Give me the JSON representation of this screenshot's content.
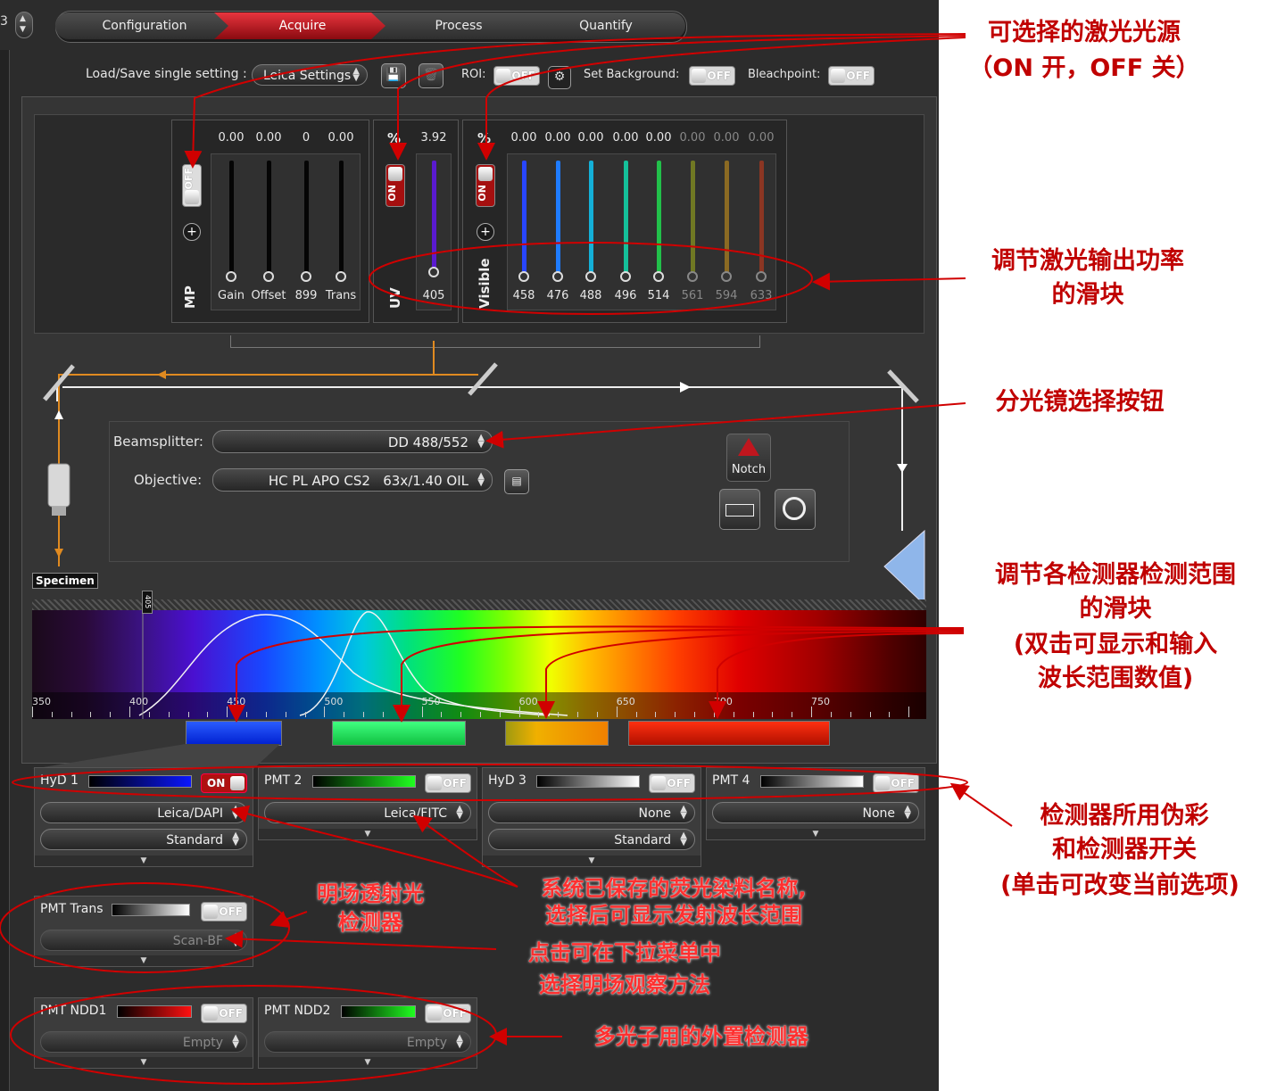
{
  "workflow": {
    "left_spinner_digit": "3",
    "tabs": [
      "Configuration",
      "Acquire",
      "Process",
      "Quantify"
    ]
  },
  "settings_row": {
    "load_save_label": "Load/Save single setting :",
    "setting_value": "Leica Settings",
    "roi_label": "ROI:",
    "roi_state": "OFF",
    "set_background_label": "Set Background:",
    "set_background_state": "OFF",
    "bleachpoint_label": "Bleachpoint:",
    "bleachpoint_state": "OFF"
  },
  "laser_panels": {
    "mp": {
      "title": "MP",
      "state": "OFF",
      "values": [
        "0.00",
        "0.00",
        "0",
        "0.00"
      ],
      "labels": [
        "Gain",
        "Offset",
        "899",
        "Trans"
      ],
      "levels": [
        0,
        0,
        0,
        0
      ]
    },
    "uv": {
      "title": "UV",
      "state": "ON",
      "unit": "%",
      "values": [
        "3.92"
      ],
      "labels": [
        "405"
      ],
      "levels": [
        0.04
      ]
    },
    "visible": {
      "title": "Visible",
      "state": "ON",
      "unit": "%",
      "values": [
        "0.00",
        "0.00",
        "0.00",
        "0.00",
        "0.00",
        "0.00",
        "0.00",
        "0.00"
      ],
      "labels": [
        "458",
        "476",
        "488",
        "496",
        "514",
        "561",
        "594",
        "633"
      ],
      "levels": [
        0,
        0,
        0,
        0,
        0,
        0,
        0,
        0
      ],
      "colors": [
        "#2846ff",
        "#1f7cff",
        "#14b0d8",
        "#15c09a",
        "#22c04a",
        "#9aa81a",
        "#c8901a",
        "#c83a1a"
      ]
    }
  },
  "optics": {
    "beamsplitter_label": "Beamsplitter:",
    "beamsplitter_value": "DD 488/552",
    "objective_label": "Objective:",
    "objective_value": "HC PL APO CS2   63x/1.40 OIL",
    "notch_label": "Notch",
    "specimen_label": "Specimen"
  },
  "spectrum": {
    "tick_labels": [
      "350",
      "400",
      "450",
      "500",
      "550",
      "600",
      "650",
      "700",
      "750"
    ],
    "laser_marker": "405"
  },
  "detectors": [
    {
      "name": "HyD 1",
      "state": "ON",
      "dye": "Leica/DAPI",
      "mode": "Standard"
    },
    {
      "name": "PMT 2",
      "state": "OFF",
      "dye": "Leica/FITC",
      "mode": ""
    },
    {
      "name": "HyD 3",
      "state": "OFF",
      "dye": "None",
      "mode": "Standard"
    },
    {
      "name": "PMT 4",
      "state": "OFF",
      "dye": "None",
      "mode": ""
    }
  ],
  "trans_detector": {
    "name": "PMT Trans",
    "state": "OFF",
    "method": "Scan-BF"
  },
  "ndd_detectors": [
    {
      "name": "PMT NDD1",
      "state": "OFF",
      "dye": "Empty"
    },
    {
      "name": "PMT NDD2",
      "state": "OFF",
      "dye": "Empty"
    }
  ],
  "annotations": {
    "laser_sources": "可选择的激光光源",
    "laser_sources_2": "（ON 开，OFF 关）",
    "power_slider": "调节激光输出功率",
    "power_slider_2": "的滑块",
    "beamsplitter_btn": "分光镜选择按钮",
    "range_slider": "调节各检测器检测范围",
    "range_slider_2": "的滑块",
    "range_slider_3": "(双击可显示和输入",
    "range_slider_4": "波长范围数值)",
    "pseudo_color": "检测器所用伪彩",
    "pseudo_color_2": "和检测器开关",
    "pseudo_color_3": "(单击可改变当前选项)",
    "trans_detector": "明场透射光",
    "trans_detector_2": "检测器",
    "dye_names": "系统已保存的荧光染料名称,",
    "dye_names_2": "选择后可显示发射波长范围",
    "brightfield": "点击可在下拉菜单中",
    "brightfield_2": "选择明场观察方法",
    "external_detectors": "多光子用的外置检测器"
  },
  "colors": {
    "active_tab": "#d0202a",
    "annotation": "#c00000",
    "on_toggle": "#b01010",
    "uv_beam": "#e08a20"
  }
}
